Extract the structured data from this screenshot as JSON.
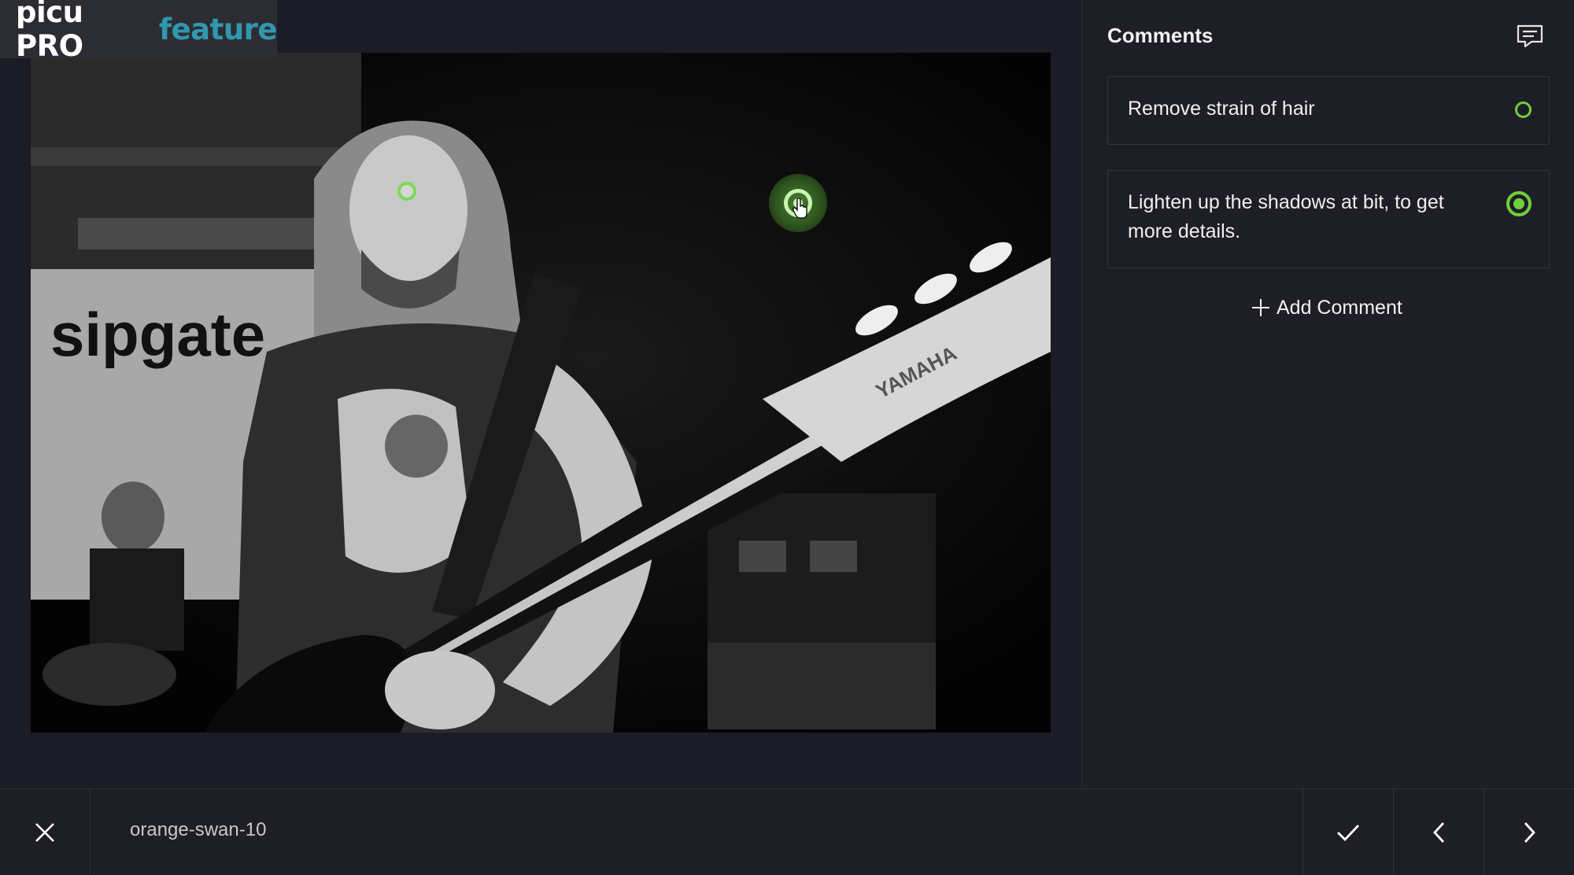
{
  "badge": {
    "brand": "picu PRO",
    "feature": "feature"
  },
  "photo": {
    "backdrop_text": "sipgate",
    "guitar_brand": "YAMAHA"
  },
  "sidebar": {
    "title": "Comments",
    "comments": [
      {
        "text": "Remove strain of hair",
        "status": "open"
      },
      {
        "text": "Lighten up the shadows at bit, to get more details.",
        "status": "active"
      }
    ],
    "add_label": "Add Comment"
  },
  "footer": {
    "filename": "orange-swan-10"
  },
  "colors": {
    "accent": "#2f98ad",
    "pin_green": "#7ed957",
    "status_green": "#6fcf3d",
    "background": "#1b1c26",
    "panel": "#1e1f26"
  },
  "icons": {
    "close": "close-icon",
    "approve": "checkmark-icon",
    "prev": "chevron-left-icon",
    "next": "chevron-right-icon",
    "comments": "comment-bubble-icon",
    "add": "plus-icon"
  }
}
